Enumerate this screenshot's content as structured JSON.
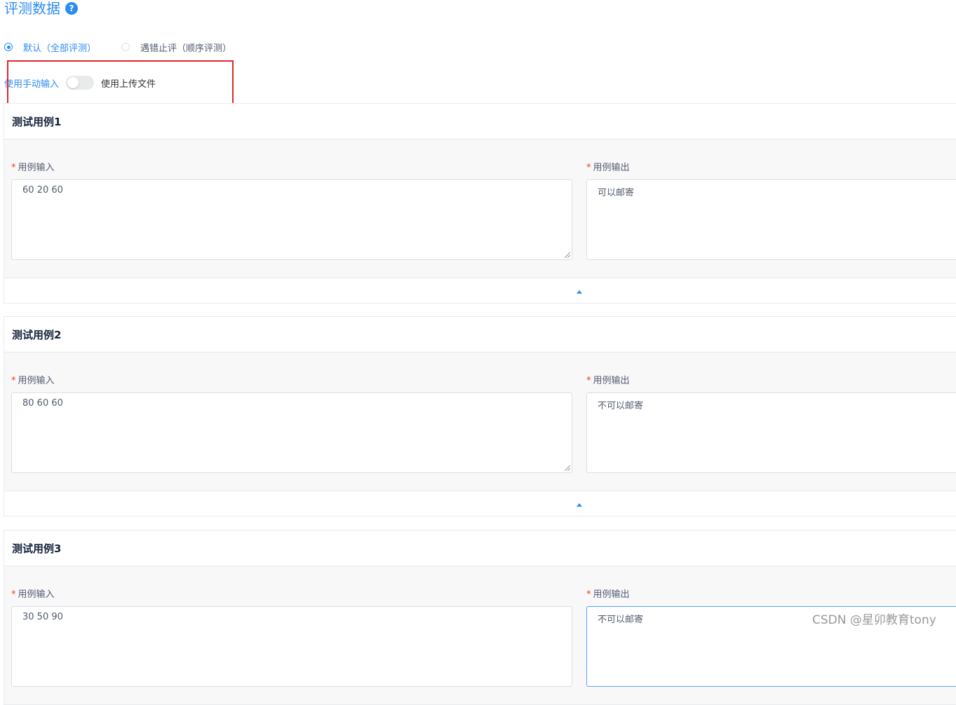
{
  "section_title": "评测数据",
  "help_icon": "?",
  "eval_mode": {
    "options": [
      {
        "label": "默认（全部评测）",
        "checked": true
      },
      {
        "label": "遇错止评（顺序评测）",
        "checked": false
      }
    ]
  },
  "input_toggle": {
    "left_label": "使用手动输入",
    "right_label": "使用上传文件",
    "on": false
  },
  "cases": [
    {
      "title": "测试用例1",
      "input_label": "用例输入",
      "output_label": "用例输出",
      "input": "60 20 60",
      "output": "可以邮寄"
    },
    {
      "title": "测试用例2",
      "input_label": "用例输入",
      "output_label": "用例输出",
      "input": "80 60 60",
      "output": "不可以邮寄"
    },
    {
      "title": "测试用例3",
      "input_label": "用例输入",
      "output_label": "用例输出",
      "input": "30 50 90",
      "output": "不可以邮寄"
    }
  ],
  "required_mark": "*",
  "colors": {
    "accent": "#2d8cf0",
    "required": "#ed4014",
    "highlight_box": "#e0262b"
  },
  "watermark": "CSDN @星卯教育tony"
}
